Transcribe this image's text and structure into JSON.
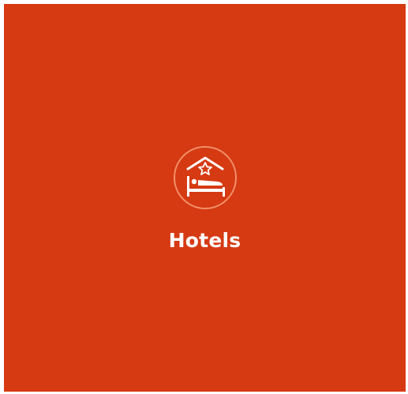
{
  "tile": {
    "label": "Hotels",
    "icon": "hotel-bed-star-icon",
    "background_color": "#d63a12",
    "ring_color": "#f2906a",
    "text_color": "#ffffff"
  }
}
